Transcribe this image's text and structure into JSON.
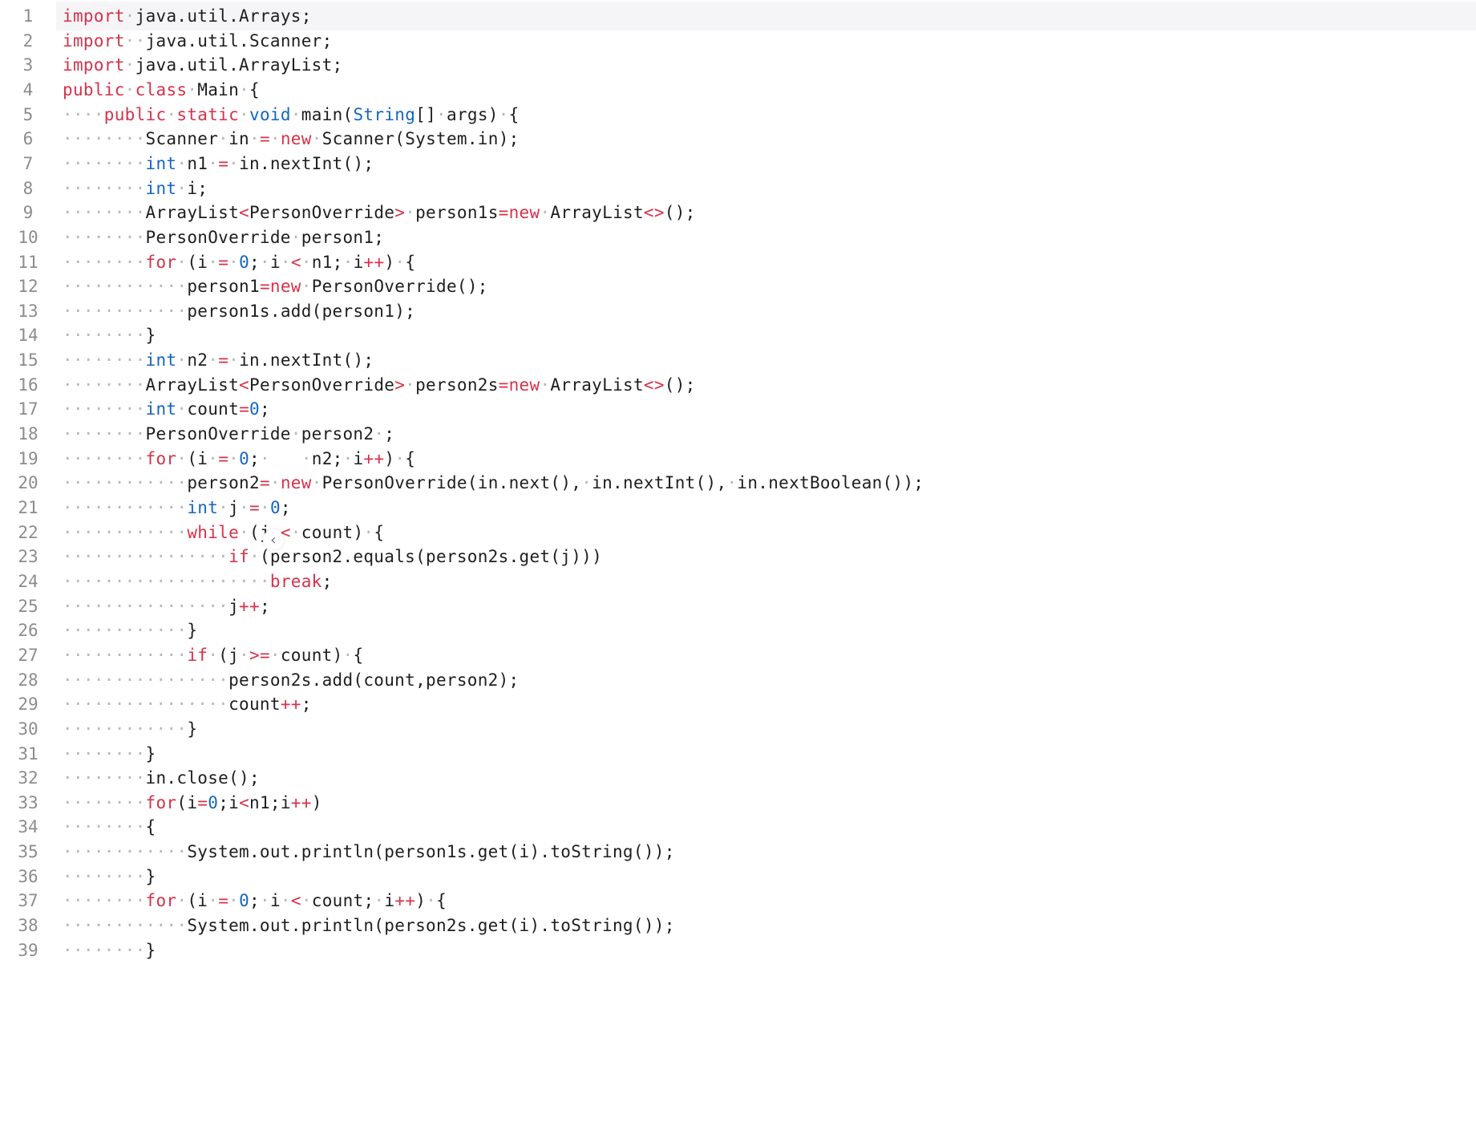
{
  "editor": {
    "language": "java",
    "current_line": 1,
    "lines": [
      {
        "n": "1",
        "tokens": [
          [
            "kw",
            "import"
          ],
          [
            "ws",
            "·"
          ],
          [
            "t",
            "java.util.Arrays;"
          ]
        ]
      },
      {
        "n": "2",
        "tokens": [
          [
            "kw",
            "import"
          ],
          [
            "ws",
            "··"
          ],
          [
            "t",
            "java.util.Scanner;"
          ]
        ]
      },
      {
        "n": "3",
        "tokens": [
          [
            "kw",
            "import"
          ],
          [
            "ws",
            "·"
          ],
          [
            "t",
            "java.util.ArrayList;"
          ]
        ]
      },
      {
        "n": "4",
        "tokens": [
          [
            "kw",
            "public"
          ],
          [
            "ws",
            "·"
          ],
          [
            "kw",
            "class"
          ],
          [
            "ws",
            "·"
          ],
          [
            "t",
            "Main"
          ],
          [
            "ws",
            "·"
          ],
          [
            "t",
            "{"
          ]
        ]
      },
      {
        "n": "5",
        "tokens": [
          [
            "ws",
            "····"
          ],
          [
            "kw",
            "public"
          ],
          [
            "ws",
            "·"
          ],
          [
            "kw",
            "static"
          ],
          [
            "ws",
            "·"
          ],
          [
            "ty",
            "void"
          ],
          [
            "ws",
            "·"
          ],
          [
            "t",
            "main("
          ],
          [
            "ty",
            "String"
          ],
          [
            "t",
            "[]"
          ],
          [
            "ws",
            "·"
          ],
          [
            "t",
            "args)"
          ],
          [
            "ws",
            "·"
          ],
          [
            "t",
            "{"
          ]
        ]
      },
      {
        "n": "6",
        "tokens": [
          [
            "ws",
            "········"
          ],
          [
            "t",
            "Scanner"
          ],
          [
            "ws",
            "·"
          ],
          [
            "t",
            "in"
          ],
          [
            "ws",
            "·"
          ],
          [
            "op",
            "="
          ],
          [
            "ws",
            "·"
          ],
          [
            "kw",
            "new"
          ],
          [
            "ws",
            "·"
          ],
          [
            "t",
            "Scanner(System.in);"
          ]
        ]
      },
      {
        "n": "7",
        "tokens": [
          [
            "ws",
            "········"
          ],
          [
            "ty",
            "int"
          ],
          [
            "ws",
            "·"
          ],
          [
            "t",
            "n1"
          ],
          [
            "ws",
            "·"
          ],
          [
            "op",
            "="
          ],
          [
            "ws",
            "·"
          ],
          [
            "t",
            "in.nextInt();"
          ]
        ]
      },
      {
        "n": "8",
        "tokens": [
          [
            "ws",
            "········"
          ],
          [
            "ty",
            "int"
          ],
          [
            "ws",
            "·"
          ],
          [
            "t",
            "i;"
          ]
        ]
      },
      {
        "n": "9",
        "tokens": [
          [
            "ws",
            "········"
          ],
          [
            "t",
            "ArrayList"
          ],
          [
            "op",
            "<"
          ],
          [
            "t",
            "PersonOverride"
          ],
          [
            "op",
            ">"
          ],
          [
            "ws",
            "·"
          ],
          [
            "t",
            "person1s"
          ],
          [
            "op",
            "="
          ],
          [
            "kw",
            "new"
          ],
          [
            "ws",
            "·"
          ],
          [
            "t",
            "ArrayList"
          ],
          [
            "op",
            "<>"
          ],
          [
            "t",
            "();"
          ]
        ]
      },
      {
        "n": "10",
        "tokens": [
          [
            "ws",
            "········"
          ],
          [
            "t",
            "PersonOverride"
          ],
          [
            "ws",
            "·"
          ],
          [
            "t",
            "person1;"
          ]
        ]
      },
      {
        "n": "11",
        "tokens": [
          [
            "ws",
            "········"
          ],
          [
            "kw",
            "for"
          ],
          [
            "ws",
            "·"
          ],
          [
            "t",
            "(i"
          ],
          [
            "ws",
            "·"
          ],
          [
            "op",
            "="
          ],
          [
            "ws",
            "·"
          ],
          [
            "num",
            "0"
          ],
          [
            "t",
            ";"
          ],
          [
            "ws",
            "·"
          ],
          [
            "t",
            "i"
          ],
          [
            "ws",
            "·"
          ],
          [
            "op",
            "<"
          ],
          [
            "ws",
            "·"
          ],
          [
            "t",
            "n1;"
          ],
          [
            "ws",
            "·"
          ],
          [
            "t",
            "i"
          ],
          [
            "op",
            "++"
          ],
          [
            "t",
            ")"
          ],
          [
            "ws",
            "·"
          ],
          [
            "t",
            "{"
          ]
        ]
      },
      {
        "n": "12",
        "tokens": [
          [
            "ws",
            "············"
          ],
          [
            "t",
            "person1"
          ],
          [
            "op",
            "="
          ],
          [
            "kw",
            "new"
          ],
          [
            "ws",
            "·"
          ],
          [
            "t",
            "PersonOverride();"
          ]
        ]
      },
      {
        "n": "13",
        "tokens": [
          [
            "ws",
            "············"
          ],
          [
            "t",
            "person1s.add(person1);"
          ]
        ]
      },
      {
        "n": "14",
        "tokens": [
          [
            "ws",
            "········"
          ],
          [
            "t",
            "}"
          ]
        ]
      },
      {
        "n": "15",
        "tokens": [
          [
            "ws",
            "········"
          ],
          [
            "ty",
            "int"
          ],
          [
            "ws",
            "·"
          ],
          [
            "t",
            "n2"
          ],
          [
            "ws",
            "·"
          ],
          [
            "op",
            "="
          ],
          [
            "ws",
            "·"
          ],
          [
            "t",
            "in.nextInt();"
          ]
        ]
      },
      {
        "n": "16",
        "tokens": [
          [
            "ws",
            "········"
          ],
          [
            "t",
            "ArrayList"
          ],
          [
            "op",
            "<"
          ],
          [
            "t",
            "PersonOverride"
          ],
          [
            "op",
            ">"
          ],
          [
            "ws",
            "·"
          ],
          [
            "t",
            "person2s"
          ],
          [
            "op",
            "="
          ],
          [
            "kw",
            "new"
          ],
          [
            "ws",
            "·"
          ],
          [
            "t",
            "ArrayList"
          ],
          [
            "op",
            "<>"
          ],
          [
            "t",
            "();"
          ]
        ]
      },
      {
        "n": "17",
        "tokens": [
          [
            "ws",
            "········"
          ],
          [
            "ty",
            "int"
          ],
          [
            "ws",
            "·"
          ],
          [
            "t",
            "count"
          ],
          [
            "op",
            "="
          ],
          [
            "num",
            "0"
          ],
          [
            "t",
            ";"
          ]
        ]
      },
      {
        "n": "18",
        "tokens": [
          [
            "ws",
            "········"
          ],
          [
            "t",
            "PersonOverride"
          ],
          [
            "ws",
            "·"
          ],
          [
            "t",
            "person2"
          ],
          [
            "ws",
            "·"
          ],
          [
            "t",
            ";"
          ]
        ]
      },
      {
        "n": "19",
        "tokens": [
          [
            "ws",
            "········"
          ],
          [
            "kw",
            "for"
          ],
          [
            "ws",
            "·"
          ],
          [
            "t",
            "(i"
          ],
          [
            "ws",
            "·"
          ],
          [
            "op",
            "="
          ],
          [
            "ws",
            "·"
          ],
          [
            "num",
            "0"
          ],
          [
            "t",
            ";"
          ],
          [
            "ws",
            "·"
          ],
          [
            "t",
            "   "
          ],
          [
            "ws",
            "·"
          ],
          [
            "t",
            "n2;"
          ],
          [
            "ws",
            "·"
          ],
          [
            "t",
            "i"
          ],
          [
            "op",
            "++"
          ],
          [
            "t",
            ")"
          ],
          [
            "ws",
            "·"
          ],
          [
            "t",
            "{"
          ]
        ]
      },
      {
        "n": "20",
        "tokens": [
          [
            "ws",
            "············"
          ],
          [
            "t",
            "person2"
          ],
          [
            "op",
            "="
          ],
          [
            "ws",
            "·"
          ],
          [
            "kw",
            "new"
          ],
          [
            "ws",
            "·"
          ],
          [
            "t",
            "PersonOverride(in.next(),"
          ],
          [
            "ws",
            "·"
          ],
          [
            "t",
            "in.nextInt(),"
          ],
          [
            "ws",
            "·"
          ],
          [
            "t",
            "in.nextBoolean());"
          ]
        ]
      },
      {
        "n": "21",
        "tokens": [
          [
            "ws",
            "············"
          ],
          [
            "ty",
            "int"
          ],
          [
            "ws",
            "·"
          ],
          [
            "t",
            "j"
          ],
          [
            "ws",
            "·"
          ],
          [
            "op",
            "="
          ],
          [
            "ws",
            "·"
          ],
          [
            "num",
            "0"
          ],
          [
            "t",
            ";"
          ]
        ]
      },
      {
        "n": "22",
        "tokens": [
          [
            "ws",
            "············"
          ],
          [
            "kw",
            "while"
          ],
          [
            "ws",
            "·"
          ],
          [
            "t",
            "(j"
          ],
          [
            "ws",
            "·"
          ],
          [
            "op",
            "<"
          ],
          [
            "ws",
            "·"
          ],
          [
            "t",
            "count)"
          ],
          [
            "ws",
            "·"
          ],
          [
            "t",
            "{"
          ]
        ]
      },
      {
        "n": "23",
        "tokens": [
          [
            "ws",
            "················"
          ],
          [
            "kw",
            "if"
          ],
          [
            "ws",
            "·"
          ],
          [
            "t",
            "(person2.equals(person2s.get(j)))"
          ]
        ]
      },
      {
        "n": "24",
        "tokens": [
          [
            "ws",
            "····················"
          ],
          [
            "kw",
            "break"
          ],
          [
            "t",
            ";"
          ]
        ]
      },
      {
        "n": "25",
        "tokens": [
          [
            "ws",
            "················"
          ],
          [
            "t",
            "j"
          ],
          [
            "op",
            "++"
          ],
          [
            "t",
            ";"
          ]
        ]
      },
      {
        "n": "26",
        "tokens": [
          [
            "ws",
            "············"
          ],
          [
            "t",
            "}"
          ]
        ]
      },
      {
        "n": "27",
        "tokens": [
          [
            "ws",
            "············"
          ],
          [
            "kw",
            "if"
          ],
          [
            "ws",
            "·"
          ],
          [
            "t",
            "(j"
          ],
          [
            "ws",
            "·"
          ],
          [
            "op",
            ">="
          ],
          [
            "ws",
            "·"
          ],
          [
            "t",
            "count)"
          ],
          [
            "ws",
            "·"
          ],
          [
            "t",
            "{"
          ]
        ]
      },
      {
        "n": "28",
        "tokens": [
          [
            "ws",
            "················"
          ],
          [
            "t",
            "person2s.add(count,person2);"
          ]
        ]
      },
      {
        "n": "29",
        "tokens": [
          [
            "ws",
            "················"
          ],
          [
            "t",
            "count"
          ],
          [
            "op",
            "++"
          ],
          [
            "t",
            ";"
          ]
        ]
      },
      {
        "n": "30",
        "tokens": [
          [
            "ws",
            "············"
          ],
          [
            "t",
            "}"
          ]
        ]
      },
      {
        "n": "31",
        "tokens": [
          [
            "ws",
            "········"
          ],
          [
            "t",
            "}"
          ]
        ]
      },
      {
        "n": "32",
        "tokens": [
          [
            "ws",
            "········"
          ],
          [
            "t",
            "in.close();"
          ]
        ]
      },
      {
        "n": "33",
        "tokens": [
          [
            "ws",
            "········"
          ],
          [
            "kw",
            "for"
          ],
          [
            "t",
            "(i"
          ],
          [
            "op",
            "="
          ],
          [
            "num",
            "0"
          ],
          [
            "t",
            ";i"
          ],
          [
            "op",
            "<"
          ],
          [
            "t",
            "n1;i"
          ],
          [
            "op",
            "++"
          ],
          [
            "t",
            ")"
          ]
        ]
      },
      {
        "n": "34",
        "tokens": [
          [
            "ws",
            "········"
          ],
          [
            "t",
            "{"
          ]
        ]
      },
      {
        "n": "35",
        "tokens": [
          [
            "ws",
            "············"
          ],
          [
            "t",
            "System.out.println(person1s.get(i).toString());"
          ]
        ]
      },
      {
        "n": "36",
        "tokens": [
          [
            "ws",
            "········"
          ],
          [
            "t",
            "}"
          ]
        ]
      },
      {
        "n": "37",
        "tokens": [
          [
            "ws",
            "········"
          ],
          [
            "kw",
            "for"
          ],
          [
            "ws",
            "·"
          ],
          [
            "t",
            "(i"
          ],
          [
            "ws",
            "·"
          ],
          [
            "op",
            "="
          ],
          [
            "ws",
            "·"
          ],
          [
            "num",
            "0"
          ],
          [
            "t",
            ";"
          ],
          [
            "ws",
            "·"
          ],
          [
            "t",
            "i"
          ],
          [
            "ws",
            "·"
          ],
          [
            "op",
            "<"
          ],
          [
            "ws",
            "·"
          ],
          [
            "t",
            "count;"
          ],
          [
            "ws",
            "·"
          ],
          [
            "t",
            "i"
          ],
          [
            "op",
            "++"
          ],
          [
            "t",
            ")"
          ],
          [
            "ws",
            "·"
          ],
          [
            "t",
            "{"
          ]
        ]
      },
      {
        "n": "38",
        "tokens": [
          [
            "ws",
            "············"
          ],
          [
            "t",
            "System.out.println(person2s.get(i).toString());"
          ]
        ]
      },
      {
        "n": "39",
        "tokens": [
          [
            "ws",
            "········"
          ],
          [
            "t",
            "}"
          ]
        ]
      }
    ]
  },
  "collapse_control": {
    "icon": "chevron-left-icon",
    "glyph": "‹"
  },
  "colors": {
    "keyword": "#d6324a",
    "type": "#1565c0",
    "whitespace": "#b8b8b8",
    "text": "#1e1e1e",
    "line_number": "#8c8c8c",
    "current_line_bg": "#f5f5f7"
  }
}
